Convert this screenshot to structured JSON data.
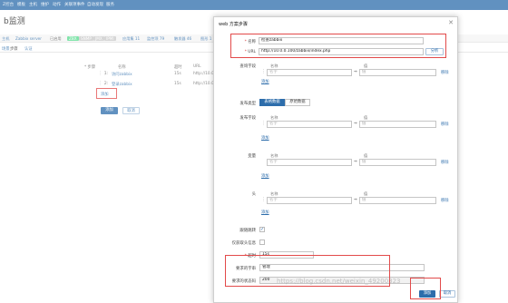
{
  "topnav": {
    "items": [
      "Z控台",
      "模板",
      "主机",
      "维护",
      "动作",
      "关联项事件",
      "自动发现",
      "服务"
    ]
  },
  "background": {
    "title": "b监测",
    "breadcrumb": {
      "items": [
        "主机",
        "Zabbix server",
        "已启用",
        "ZBX",
        "SNMP",
        "JMX",
        "IPMI",
        "应用集 11",
        "监控项 79",
        "触发器 46",
        "图形 1"
      ]
    },
    "tabs": [
      "场景",
      "步骤",
      "认证"
    ],
    "steps": {
      "label": "* 步骤",
      "headers": [
        "名称",
        "超时",
        "URL"
      ],
      "rows": [
        {
          "num": "1:",
          "name": "访问zabbix",
          "timeout": "15s",
          "url": "http://10.0"
        },
        {
          "num": "2:",
          "name": "登录zabbix",
          "timeout": "15s",
          "url": "http://10.0"
        }
      ],
      "add_link": "添加"
    },
    "add_button": "添加",
    "cancel_button": "取消"
  },
  "dialog": {
    "title": "web 方案步骤",
    "name_label": "名称",
    "name_value": "检查zabbix",
    "url_label": "URL",
    "url_value": "http://10.0.0.100/zabbix/index.php",
    "parse_button": "分析",
    "query_fields_label": "查询字段",
    "name_col": "名称",
    "value_col": "值",
    "name_placeholder": "名字",
    "value_placeholder": "值",
    "remove_link": "移除",
    "add_link": "添加",
    "post_type_label": "发布类型",
    "post_type_options": [
      "表格数据",
      "原始数据"
    ],
    "post_fields_label": "发布字段",
    "variables_label": "变量",
    "headers_label": "头",
    "follow_redirects_label": "跟随跳转",
    "follow_redirects_checked": "✓",
    "retrieve_headers_label": "仅获取头信息",
    "timeout_label": "超时",
    "timeout_value": "15s",
    "required_string_label": "要求的字串",
    "required_string_value": "管理",
    "status_codes_label": "要求的状态码",
    "status_codes_value": "200",
    "add_button": "添加",
    "cancel_button": "取消",
    "accent_color": "#2d6dab",
    "highlight_color": "#e24a4a"
  },
  "watermark": "https://blog.csdn.net/weixin_49200323"
}
